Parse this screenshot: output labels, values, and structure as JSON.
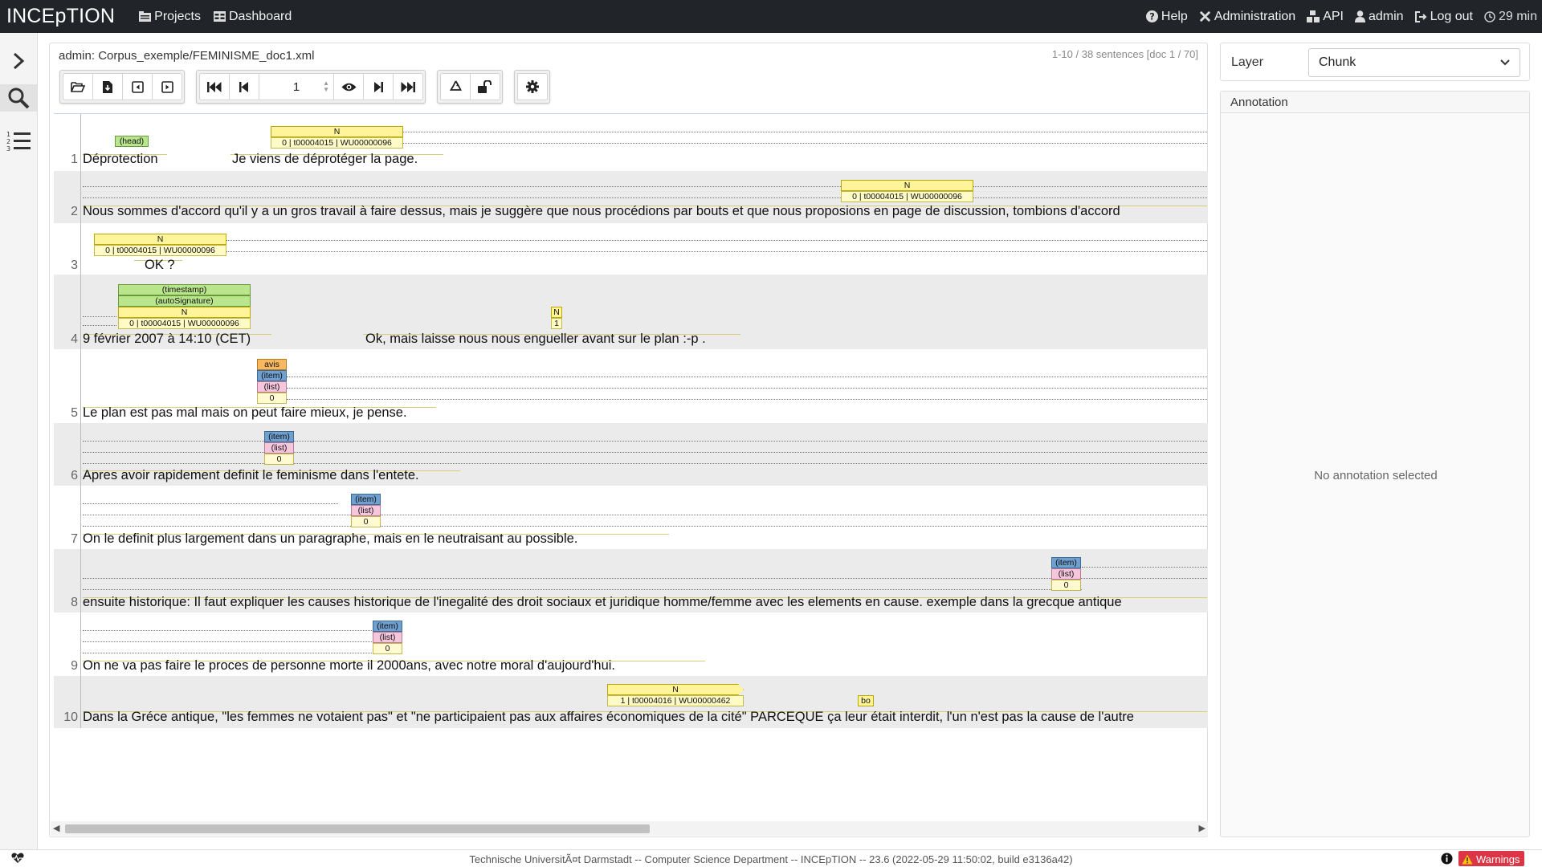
{
  "navbar": {
    "brand": "INCEpTION",
    "projects": "Projects",
    "dashboard": "Dashboard",
    "help": "Help",
    "administration": "Administration",
    "api": "API",
    "user": "admin",
    "logout": "Log out",
    "timer": "29 min"
  },
  "document": {
    "title": "admin: Corpus_exemple/FEMINISME_doc1.xml",
    "sentence_info": "1-10 / 38 sentences [doc 1 / 70]",
    "page_value": "1"
  },
  "sentences": [
    {
      "no": "1",
      "text": "Déprotection",
      "text2": "Je viens de déprotéger la page."
    },
    {
      "no": "2",
      "text": "Nous sommes d'accord qu'il y a un gros travail à faire dessus, mais je suggère que nous procédions par bouts et que nous proposions en page de discussion, tombions d'accord"
    },
    {
      "no": "3",
      "text": "OK ?"
    },
    {
      "no": "4",
      "text": "9 février 2007 à 14:10 (CET)",
      "text2": "Ok, mais laisse nous nous engueller avant sur le plan :-p ."
    },
    {
      "no": "5",
      "text": "Le plan est pas mal mais on peut faire mieux, je pense."
    },
    {
      "no": "6",
      "text": "Apres avoir rapidement definit le feminisme dans l'entete."
    },
    {
      "no": "7",
      "text": "On le definit plus largement dans un paragraphe, mais en le neutraisant au possible."
    },
    {
      "no": "8",
      "text": "ensuite historique: Il faut expliquer les causes historique de l'inegalité des droit sociaux et juridique homme/femme avec les elements en cause. exemple dans la grecque antique"
    },
    {
      "no": "9",
      "text": "On ne va pas faire le proces de personne morte il 2000ans, avec notre moral d'aujourd'hui."
    },
    {
      "no": "10",
      "text": "Dans la Gréce antique, \"les femmes ne votaient pas\" et \"ne participaient pas aux affaires économiques de la cité\" PARCEQUE ça leur était interdit, l'un n'est pas la cause de l'autre"
    }
  ],
  "annotations": {
    "head": "(head)",
    "n": "N",
    "id1": "0 | t00004015 | WU00000096",
    "id2": "1 | t00004016 | WU00000462",
    "timestamp": "(timestamp)",
    "autosig": "(autoSignature)",
    "one": "1",
    "avis": "avis",
    "item": "(item)",
    "list": "(list)",
    "zero": "0",
    "bo": "bo"
  },
  "right_panel": {
    "layer_label": "Layer",
    "layer_value": "Chunk",
    "annotation_header": "Annotation",
    "empty_text": "No annotation selected"
  },
  "footer": {
    "text": "Technische UniversitÃ¤t Darmstadt -- Computer Science Department -- INCEpTION -- 23.6 (2022-05-29 11:50:02, build e3136a42)",
    "warnings": "Warnings"
  },
  "colors": {
    "navbar": "#212529",
    "chip_yellow": "#fff49a",
    "chip_green": "#b9e58d",
    "chip_orange": "#f7b860",
    "chip_blue": "#6fa0cf",
    "chip_pink": "#f5c6dc",
    "warning_red": "#dc3545"
  }
}
